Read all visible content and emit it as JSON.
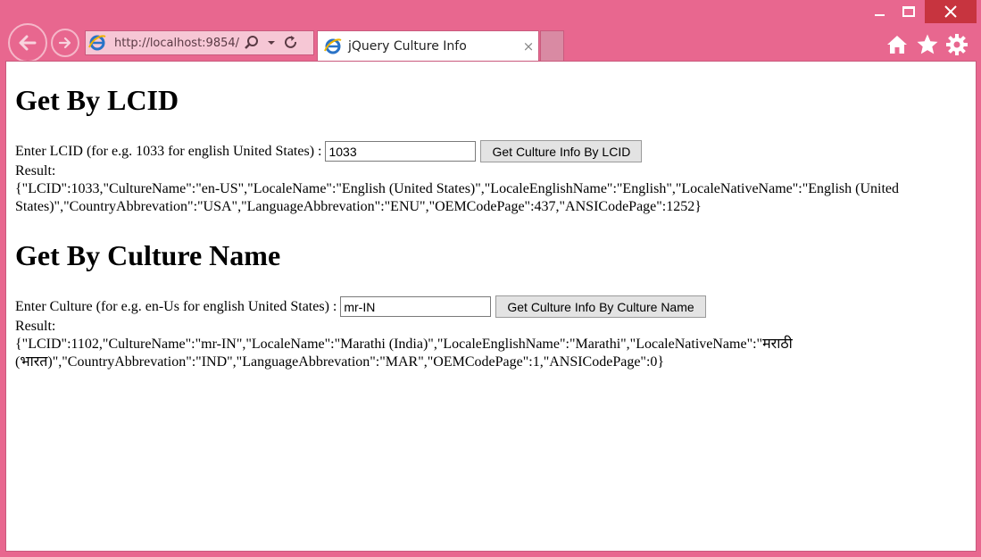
{
  "window": {
    "controls": {
      "minimize": "minimize",
      "maximize": "maximize",
      "close": "close"
    },
    "accent": "#e8678f",
    "close_color": "#c7343f"
  },
  "browser": {
    "address": "http://localhost:9854/",
    "tab_title": "jQuery Culture Info",
    "tab_close": "×",
    "icons": [
      "back-icon",
      "forward-icon",
      "ie-logo-icon",
      "search-icon",
      "dropdown-icon",
      "refresh-icon",
      "home-icon",
      "star-icon",
      "gear-icon"
    ]
  },
  "page": {
    "lcid_section": {
      "heading": "Get By LCID",
      "prompt": "Enter LCID (for e.g. 1033 for english United States) :",
      "input_value": "1033",
      "button_label": "Get Culture Info By LCID",
      "result_label": "Result:",
      "result_json": "{\"LCID\":1033,\"CultureName\":\"en-US\",\"LocaleName\":\"English (United States)\",\"LocaleEnglishName\":\"English\",\"LocaleNativeName\":\"English (United States)\",\"CountryAbbrevation\":\"USA\",\"LanguageAbbrevation\":\"ENU\",\"OEMCodePage\":437,\"ANSICodePage\":1252}"
    },
    "culture_section": {
      "heading": "Get By Culture Name",
      "prompt": "Enter Culture (for e.g. en-Us for english United States) :",
      "input_value": "mr-IN",
      "button_label": "Get Culture Info By Culture Name",
      "result_label": "Result:",
      "result_json": "{\"LCID\":1102,\"CultureName\":\"mr-IN\",\"LocaleName\":\"Marathi (India)\",\"LocaleEnglishName\":\"Marathi\",\"LocaleNativeName\":\"मराठी (भारत)\",\"CountryAbbrevation\":\"IND\",\"LanguageAbbrevation\":\"MAR\",\"OEMCodePage\":1,\"ANSICodePage\":0}"
    }
  }
}
